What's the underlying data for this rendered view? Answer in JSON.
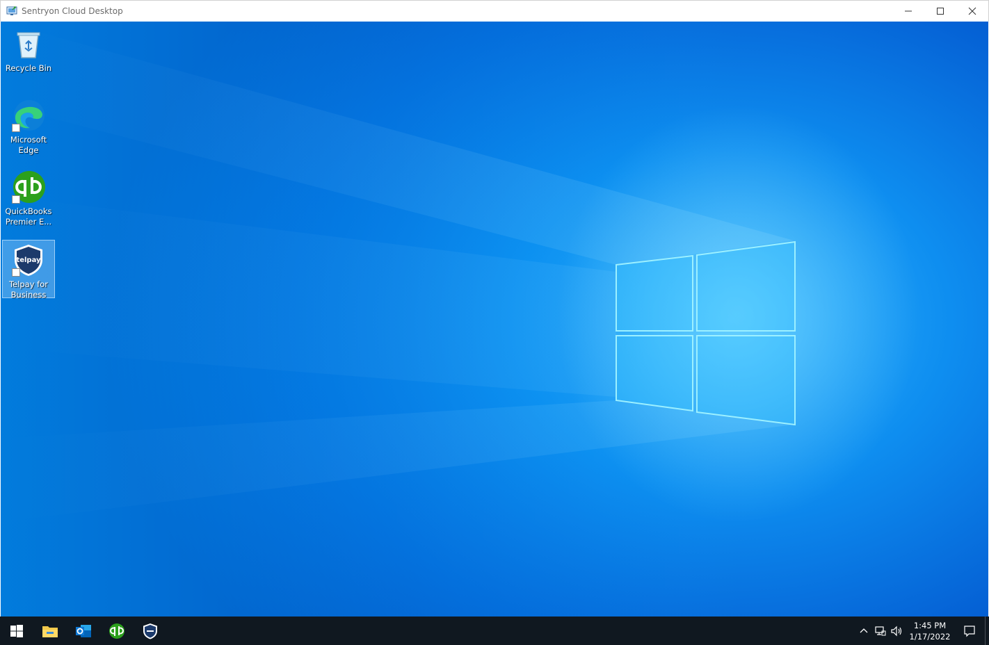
{
  "window": {
    "title": "Sentryon Cloud Desktop",
    "minimize_icon": "minimize-icon",
    "maximize_icon": "maximize-icon",
    "close_icon": "close-icon"
  },
  "desktop": {
    "icons": [
      {
        "label": "Recycle Bin",
        "icon": "recycle-bin-icon"
      },
      {
        "label": "Microsoft Edge",
        "icon": "edge-icon"
      },
      {
        "label": "QuickBooks Premier E...",
        "icon": "quickbooks-icon"
      },
      {
        "label": "Telpay for Business",
        "icon": "telpay-icon",
        "selected": true
      }
    ],
    "telpay_logo_text": "telpay"
  },
  "taskbar": {
    "items": [
      "start-icon",
      "file-explorer-icon",
      "outlook-icon",
      "quickbooks-icon",
      "telpay-icon"
    ],
    "tray": {
      "time": "1:45 PM",
      "date": "1/17/2022"
    }
  },
  "colors": {
    "taskbar": "#101820",
    "desktop_accent": "#0e8ef0",
    "quickbooks_green": "#2ca01c",
    "telpay_navy": "#1c3a6b"
  }
}
